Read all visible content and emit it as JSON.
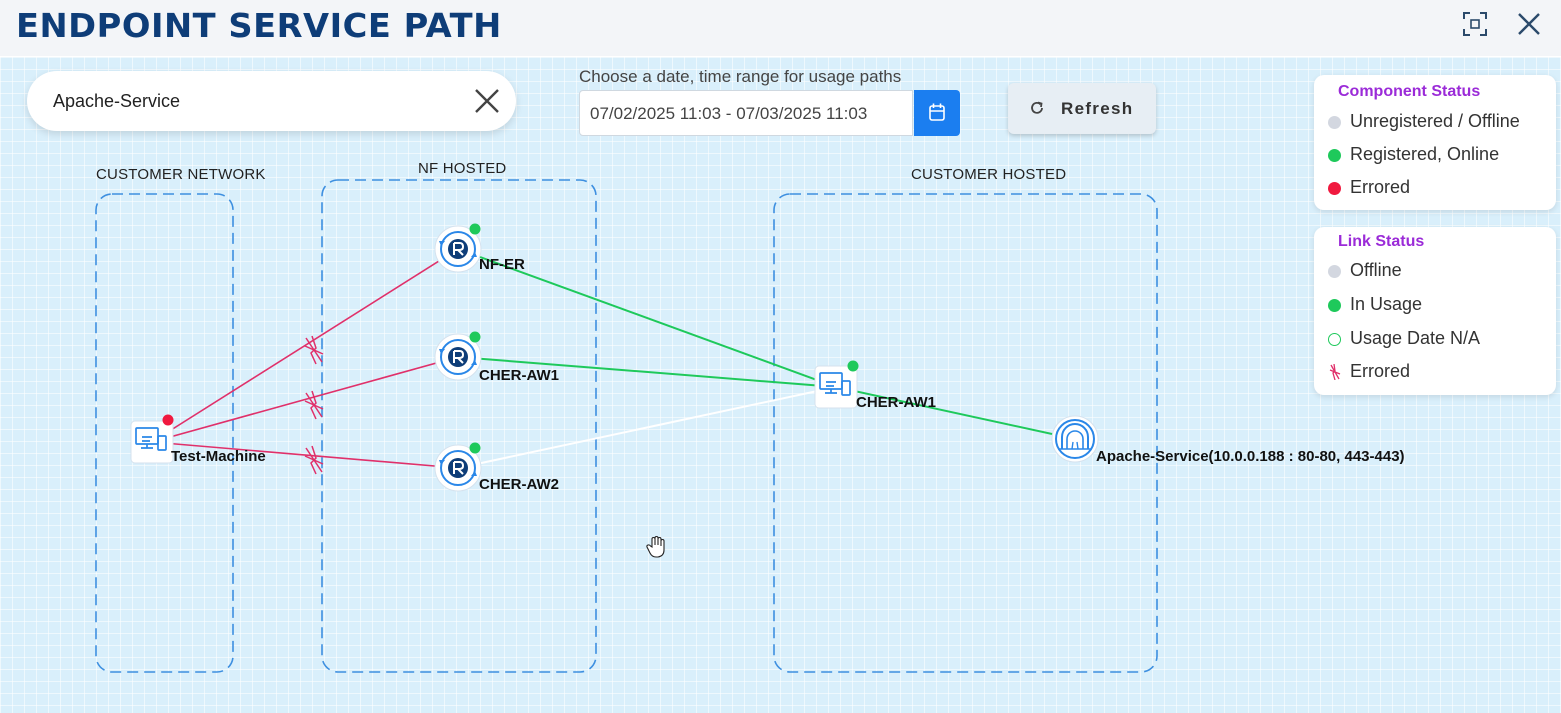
{
  "header": {
    "title": "ENDPOINT SERVICE PATH",
    "fullscreen_icon": "fullscreen-icon",
    "close_icon": "close-icon"
  },
  "search": {
    "value": "Apache-Service",
    "clear_icon": "close-icon"
  },
  "date_range": {
    "label": "Choose a date, time range for usage paths",
    "value": "07/02/2025 11:03 - 07/03/2025 11:03",
    "calendar_icon": "calendar-icon"
  },
  "refresh": {
    "label": "Refresh",
    "icon": "refresh-icon"
  },
  "component_status": {
    "title": "Component Status",
    "items": [
      {
        "label": "Unregistered / Offline",
        "color": "#d3d7e0"
      },
      {
        "label": "Registered, Online",
        "color": "#1ec95b"
      },
      {
        "label": "Errored",
        "color": "#f0193f"
      }
    ]
  },
  "link_status": {
    "title": "Link Status",
    "items": [
      {
        "label": "Offline",
        "color": "#d3d7e0"
      },
      {
        "label": "In Usage",
        "color": "#1ec95b"
      },
      {
        "label": "Usage Date N/A",
        "color": "#1ec95b"
      },
      {
        "label": "Errored",
        "color": "#e0306a"
      }
    ]
  },
  "zones": {
    "customer_network": "CUSTOMER NETWORK",
    "nf_hosted": "NF HOSTED",
    "customer_hosted": "CUSTOMER HOSTED"
  },
  "nodes": {
    "test_machine": "Test-Machine",
    "nf_er": "NF-ER",
    "cher_aw1_router": "CHER-AW1",
    "cher_aw2_router": "CHER-AW2",
    "cher_aw1_host": "CHER-AW1",
    "apache_service": "Apache-Service(10.0.0.188 : 80-80, 443-443)"
  },
  "colors": {
    "title": "#0e3d78",
    "online": "#1ec95b",
    "errored": "#f0193f",
    "errored_link": "#e0306a",
    "zone_border": "#3d8fe0",
    "accent": "#1b7ef0",
    "legend_title": "#9b2bd8"
  }
}
